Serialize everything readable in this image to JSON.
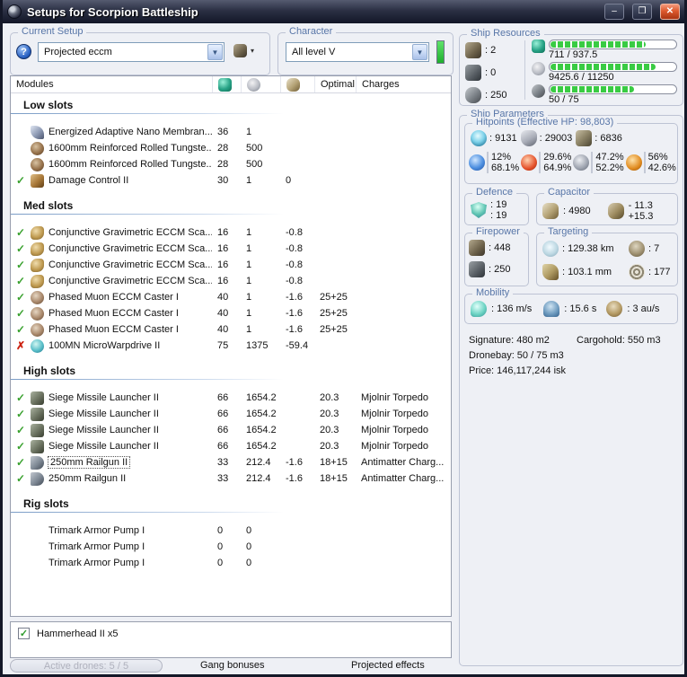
{
  "window": {
    "title": "Setups for Scorpion Battleship"
  },
  "titlebar": {
    "minimize": "–",
    "maximize": "❐",
    "close": "✕"
  },
  "current_setup": {
    "label": "Current Setup",
    "value": "Projected eccm",
    "help": "?",
    "menu_caret": "▾"
  },
  "character": {
    "label": "Character",
    "value": "All level V"
  },
  "ship_resources": {
    "label": "Ship Resources",
    "turrets": ": 2",
    "launchers": ": 0",
    "calibration": ": 250",
    "cpu": {
      "text": "711 / 937.5",
      "pct": 76
    },
    "powergrid": {
      "text": "9425.6 / 11250",
      "pct": 84
    },
    "rig_calibration": {
      "text": "50 / 75",
      "pct": 67
    }
  },
  "modules_table": {
    "title": "Modules",
    "col_optimal": "Optimal",
    "col_charges": "Charges",
    "sections": [
      {
        "name": "Low slots",
        "rows": [
          {
            "status": "",
            "icon": "membrane",
            "name": "Energized Adaptive Nano Membran...",
            "cpu": "36",
            "pg": "1",
            "cap": "",
            "optimal": "",
            "charges": "",
            "selected": false
          },
          {
            "status": "",
            "icon": "plate",
            "name": "1600mm Reinforced Rolled Tungste...",
            "cpu": "28",
            "pg": "500",
            "cap": "",
            "optimal": "",
            "charges": "",
            "selected": false
          },
          {
            "status": "",
            "icon": "plate",
            "name": "1600mm Reinforced Rolled Tungste...",
            "cpu": "28",
            "pg": "500",
            "cap": "",
            "optimal": "",
            "charges": "",
            "selected": false
          },
          {
            "status": "check",
            "icon": "damagecontrol",
            "name": "Damage Control II",
            "cpu": "30",
            "pg": "1",
            "cap": "0",
            "optimal": "",
            "charges": "",
            "selected": false
          }
        ]
      },
      {
        "name": "Med slots",
        "rows": [
          {
            "status": "check",
            "icon": "eccm-scanner",
            "name": "Conjunctive Gravimetric ECCM Sca...",
            "cpu": "16",
            "pg": "1",
            "cap": "-0.8",
            "optimal": "",
            "charges": "",
            "selected": false
          },
          {
            "status": "check",
            "icon": "eccm-scanner",
            "name": "Conjunctive Gravimetric ECCM Sca...",
            "cpu": "16",
            "pg": "1",
            "cap": "-0.8",
            "optimal": "",
            "charges": "",
            "selected": false
          },
          {
            "status": "check",
            "icon": "eccm-scanner",
            "name": "Conjunctive Gravimetric ECCM Sca...",
            "cpu": "16",
            "pg": "1",
            "cap": "-0.8",
            "optimal": "",
            "charges": "",
            "selected": false
          },
          {
            "status": "check",
            "icon": "eccm-scanner",
            "name": "Conjunctive Gravimetric ECCM Sca...",
            "cpu": "16",
            "pg": "1",
            "cap": "-0.8",
            "optimal": "",
            "charges": "",
            "selected": false
          },
          {
            "status": "check",
            "icon": "eccm-caster",
            "name": "Phased Muon ECCM Caster I",
            "cpu": "40",
            "pg": "1",
            "cap": "-1.6",
            "optimal": "25+25",
            "charges": "",
            "selected": false
          },
          {
            "status": "check",
            "icon": "eccm-caster",
            "name": "Phased Muon ECCM Caster I",
            "cpu": "40",
            "pg": "1",
            "cap": "-1.6",
            "optimal": "25+25",
            "charges": "",
            "selected": false
          },
          {
            "status": "check",
            "icon": "eccm-caster",
            "name": "Phased Muon ECCM Caster I",
            "cpu": "40",
            "pg": "1",
            "cap": "-1.6",
            "optimal": "25+25",
            "charges": "",
            "selected": false
          },
          {
            "status": "cross",
            "icon": "mwd",
            "name": "100MN MicroWarpdrive II",
            "cpu": "75",
            "pg": "1375",
            "cap": "-59.4",
            "optimal": "",
            "charges": "",
            "selected": false
          }
        ]
      },
      {
        "name": "High slots",
        "rows": [
          {
            "status": "check",
            "icon": "launcher",
            "name": "Siege Missile Launcher II",
            "cpu": "66",
            "pg": "1654.2",
            "cap": "",
            "optimal": "20.3",
            "charges": "Mjolnir Torpedo",
            "selected": false
          },
          {
            "status": "check",
            "icon": "launcher",
            "name": "Siege Missile Launcher II",
            "cpu": "66",
            "pg": "1654.2",
            "cap": "",
            "optimal": "20.3",
            "charges": "Mjolnir Torpedo",
            "selected": false
          },
          {
            "status": "check",
            "icon": "launcher",
            "name": "Siege Missile Launcher II",
            "cpu": "66",
            "pg": "1654.2",
            "cap": "",
            "optimal": "20.3",
            "charges": "Mjolnir Torpedo",
            "selected": false
          },
          {
            "status": "check",
            "icon": "launcher",
            "name": "Siege Missile Launcher II",
            "cpu": "66",
            "pg": "1654.2",
            "cap": "",
            "optimal": "20.3",
            "charges": "Mjolnir Torpedo",
            "selected": false
          },
          {
            "status": "check",
            "icon": "railgun",
            "name": "250mm Railgun II",
            "cpu": "33",
            "pg": "212.4",
            "cap": "-1.6",
            "optimal": "18+15",
            "charges": "Antimatter Charg...",
            "selected": true
          },
          {
            "status": "check",
            "icon": "railgun",
            "name": "250mm Railgun II",
            "cpu": "33",
            "pg": "212.4",
            "cap": "-1.6",
            "optimal": "18+15",
            "charges": "Antimatter Charg...",
            "selected": false
          }
        ]
      },
      {
        "name": "Rig slots",
        "rows": [
          {
            "status": "",
            "icon": "rig",
            "name": "Trimark Armor Pump I",
            "cpu": "0",
            "pg": "0",
            "cap": "",
            "optimal": "",
            "charges": "",
            "selected": false
          },
          {
            "status": "",
            "icon": "rig",
            "name": "Trimark Armor Pump I",
            "cpu": "0",
            "pg": "0",
            "cap": "",
            "optimal": "",
            "charges": "",
            "selected": false
          },
          {
            "status": "",
            "icon": "rig",
            "name": "Trimark Armor Pump I",
            "cpu": "0",
            "pg": "0",
            "cap": "",
            "optimal": "",
            "charges": "",
            "selected": false
          }
        ]
      }
    ]
  },
  "ship_parameters": {
    "label": "Ship Parameters",
    "hitpoints": {
      "label": "Hitpoints (Effective HP: 98,803)",
      "shield": ": 9131",
      "armor": ": 29003",
      "structure": ": 6836",
      "em_a": "12%",
      "em_b": "68.1%",
      "thermal_a": "29.6%",
      "thermal_b": "64.9%",
      "kinetic_a": "47.2%",
      "kinetic_b": "52.2%",
      "explosive_a": "56%",
      "explosive_b": "42.6%"
    },
    "defence": {
      "label": "Defence",
      "a": ": 19",
      "b": ": 19"
    },
    "capacitor": {
      "label": "Capacitor",
      "amount": ": 4980",
      "drain": "- 11.3",
      "recharge": "+15.3"
    },
    "firepower": {
      "label": "Firepower",
      "turret": ": 448",
      "missile": ": 250"
    },
    "targeting": {
      "label": "Targeting",
      "range": ": 129.38 km",
      "max_targets": ": 7",
      "scan_res": ": 103.1 mm",
      "sensor_str": ": 177"
    },
    "mobility": {
      "label": "Mobility",
      "speed": ": 136 m/s",
      "align": ": 15.6 s",
      "warp": ": 3 au/s"
    },
    "stats": {
      "signature": "Signature: 480 m2",
      "cargohold": "Cargohold: 550 m3",
      "dronebay": "Dronebay: 50 / 75 m3",
      "price": "Price: 146,117,244 isk"
    }
  },
  "drones": {
    "items": [
      {
        "checked": "✓",
        "label": "Hammerhead II x5"
      }
    ]
  },
  "bottom_bar": {
    "active_drones": "Active drones: 5 / 5",
    "gang_bonuses": "Gang bonuses",
    "projected_effects": "Projected effects"
  }
}
